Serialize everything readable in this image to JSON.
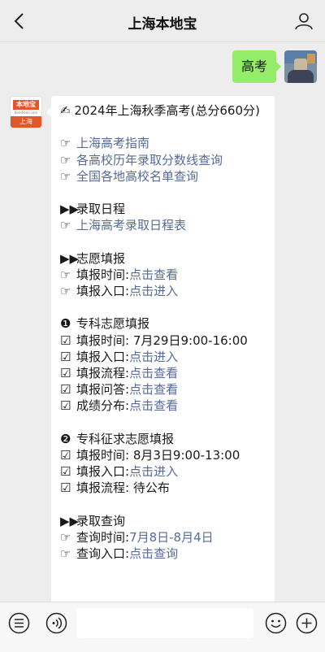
{
  "header": {
    "title": "上海本地宝"
  },
  "outgoing": {
    "text": "高考"
  },
  "bot_avatar": {
    "top": "本地宝",
    "mid": "Bendibao.com",
    "bottom": "上海"
  },
  "message": {
    "title_icon": "✍",
    "title": "2024年上海秋季高考(总分660分)",
    "hand": "☞",
    "arrows": "▶▶",
    "check": "☑",
    "links1": [
      "上海高考指南",
      "各高校历年录取分数线查询",
      "全国各地高校名单查询"
    ],
    "s1_title": "录取日程",
    "s1_link": "上海高考录取日程表",
    "s2_title": "志愿填报",
    "s2_rows": [
      {
        "label": "填报时间:",
        "value": "点击查看"
      },
      {
        "label": "填报入口:",
        "value": "点击进入"
      }
    ],
    "sub1_num": "❶",
    "sub1_title": "专科志愿填报",
    "sub1_rows": [
      {
        "label": "填报时间:",
        "value": "7月29日9:00-16:00"
      },
      {
        "label": "填报入口:",
        "value": "点击进入"
      },
      {
        "label": "填报流程:",
        "value": "点击查看"
      },
      {
        "label": "填报问答:",
        "value": "点击查看"
      },
      {
        "label": "成绩分布:",
        "value": "点击查看"
      }
    ],
    "sub2_num": "❷",
    "sub2_title": "专科征求志愿填报",
    "sub2_rows": [
      {
        "label": "填报时间:",
        "value": "8月3日9:00-13:00"
      },
      {
        "label": "填报入口:",
        "value": "点击进入"
      },
      {
        "label": "填报流程:",
        "value": "待公布"
      }
    ],
    "s3_title": "录取查询",
    "s3_rows": [
      {
        "label": "查询时间:",
        "value": "7月8日-8月4日"
      },
      {
        "label": "查询入口:",
        "value": "点击查询"
      }
    ]
  },
  "icons": {
    "back": "back-icon",
    "profile": "profile-icon",
    "list": "list-icon",
    "voice": "voice-icon",
    "emoji": "emoji-icon",
    "plus": "plus-icon"
  },
  "colors": {
    "bubble_out": "#95ec69",
    "link": "#576b95",
    "brand": "#e0582a"
  }
}
